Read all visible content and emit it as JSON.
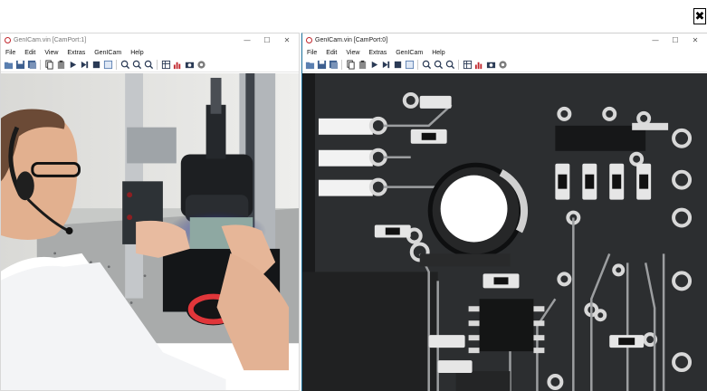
{
  "close_button": {
    "glyph": "✖"
  },
  "left_window": {
    "title": "GenICam.vin [CamPort:1]",
    "menu": [
      "File",
      "Edit",
      "View",
      "Extras",
      "GenICam",
      "Help"
    ]
  },
  "right_window": {
    "title": "GenICam.vin [CamPort:0]",
    "menu": [
      "File",
      "Edit",
      "View",
      "Extras",
      "GenICam",
      "Help"
    ]
  },
  "window_controls": {
    "minimize": "—",
    "maximize": "☐",
    "close": "✕"
  },
  "toolbar_icons": [
    "open-icon",
    "save-icon",
    "save-all-icon",
    "copy-icon",
    "paste-icon",
    "play-icon",
    "step-icon",
    "stop-icon",
    "fit-icon",
    "zoom-in-icon",
    "zoom-out-icon",
    "zoom-reset-icon",
    "grid-icon",
    "histogram-icon",
    "camera-icon",
    "settings-icon"
  ],
  "colors": {
    "accent": "#1b6f9a",
    "brand_red": "#c1272d",
    "toolbar_blue": "#2a3a55"
  }
}
